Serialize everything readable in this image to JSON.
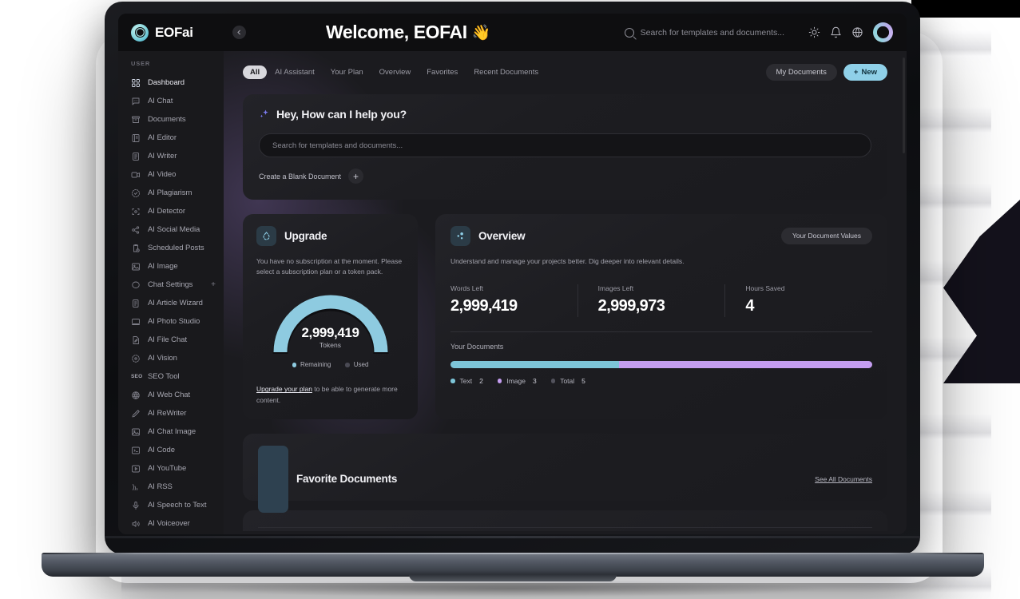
{
  "brand": {
    "name": "EOFai",
    "mark_icon": "eofai-logo-icon"
  },
  "header": {
    "collapse_icon": "chevron-left-icon",
    "welcome": "Welcome, EOFAI",
    "wave_emoji": "👋",
    "search_placeholder": "Search for templates and documents...",
    "search_icon": "search-icon",
    "icons": [
      {
        "name": "theme-toggle-icon",
        "glyph": "sun-icon"
      },
      {
        "name": "notifications-icon",
        "glyph": "bell-icon"
      },
      {
        "name": "language-icon",
        "glyph": "globe-icon"
      }
    ],
    "avatar_name": "user-avatar"
  },
  "sidebar": {
    "section_label": "USER",
    "items": [
      {
        "label": "Dashboard",
        "icon": "grid-icon",
        "active": true
      },
      {
        "label": "AI Chat",
        "icon": "chat-bubble-icon",
        "active": false
      },
      {
        "label": "Documents",
        "icon": "archive-icon",
        "active": false
      },
      {
        "label": "AI Editor",
        "icon": "book-icon",
        "active": false
      },
      {
        "label": "AI Writer",
        "icon": "document-icon",
        "active": false
      },
      {
        "label": "AI Video",
        "icon": "video-camera-icon",
        "active": false
      },
      {
        "label": "AI Plagiarism",
        "icon": "check-circle-icon",
        "active": false
      },
      {
        "label": "AI Detector",
        "icon": "scan-icon",
        "active": false
      },
      {
        "label": "AI Social Media",
        "icon": "share-nodes-icon",
        "active": false
      },
      {
        "label": "Scheduled Posts",
        "icon": "clipboard-clock-icon",
        "active": false
      },
      {
        "label": "AI Image",
        "icon": "image-icon",
        "active": false
      },
      {
        "label": "Chat Settings",
        "icon": "chat-circle-icon",
        "active": false,
        "trailing": "+"
      },
      {
        "label": "AI Article Wizard",
        "icon": "article-wand-icon",
        "active": false
      },
      {
        "label": "AI Photo Studio",
        "icon": "monitor-icon",
        "active": false
      },
      {
        "label": "AI File Chat",
        "icon": "file-pen-icon",
        "active": false
      },
      {
        "label": "AI Vision",
        "icon": "eye-scan-icon",
        "active": false
      },
      {
        "label": "SEO Tool",
        "icon": "seo-text-icon",
        "active": false
      },
      {
        "label": "AI Web Chat",
        "icon": "globe-icon",
        "active": false
      },
      {
        "label": "AI ReWriter",
        "icon": "pencil-icon",
        "active": false
      },
      {
        "label": "AI Chat Image",
        "icon": "image-icon",
        "active": false
      },
      {
        "label": "AI Code",
        "icon": "terminal-icon",
        "active": false
      },
      {
        "label": "AI YouTube",
        "icon": "play-box-icon",
        "active": false
      },
      {
        "label": "AI RSS",
        "icon": "rss-icon",
        "active": false
      },
      {
        "label": "AI Speech to Text",
        "icon": "microphone-icon",
        "active": false
      },
      {
        "label": "AI Voiceover",
        "icon": "speaker-icon",
        "active": false
      }
    ]
  },
  "tabs": [
    {
      "label": "All",
      "active": true
    },
    {
      "label": "AI Assistant",
      "active": false
    },
    {
      "label": "Your Plan",
      "active": false
    },
    {
      "label": "Overview",
      "active": false
    },
    {
      "label": "Favorites",
      "active": false
    },
    {
      "label": "Recent Documents",
      "active": false
    }
  ],
  "toolbar": {
    "my_documents_label": "My Documents",
    "new_label": "New",
    "new_plus": "+"
  },
  "hero": {
    "icon": "sparkle-icon",
    "title": "Hey, How can I help you?",
    "search_placeholder": "Search for templates and documents...",
    "search_value": "",
    "blank_doc_label": "Create a Blank Document",
    "blank_doc_plus": "+"
  },
  "upgrade": {
    "icon": "upgrade-droplet-icon",
    "title": "Upgrade",
    "description": "You have no subscription at the moment. Please select a subscription plan or a token pack.",
    "gauge_value": "2,999,419",
    "gauge_label": "Tokens",
    "legend": [
      {
        "label": "Remaining",
        "color": "#8ecbe0"
      },
      {
        "label": "Used",
        "color": "#4a4a54"
      }
    ],
    "footer_link": "Upgrade your plan",
    "footer_text": " to be able to generate more content.",
    "remaining_percent": 100
  },
  "overview": {
    "icon": "overview-dots-icon",
    "title": "Overview",
    "pill_label": "Your Document Values",
    "description": "Understand and manage your projects better. Dig deeper into relevant details.",
    "stats": [
      {
        "label": "Words Left",
        "value": "2,999,419"
      },
      {
        "label": "Images Left",
        "value": "2,999,973"
      },
      {
        "label": "Hours Saved",
        "value": "4"
      }
    ],
    "documents_label": "Your Documents",
    "bar_segments": [
      {
        "label": "Text",
        "count": 2,
        "color": "#7dc5d8",
        "percent": 40
      },
      {
        "label": "Image",
        "count": 3,
        "color": "#c49df0",
        "percent": 60
      }
    ],
    "bar_legend": [
      {
        "label": "Text",
        "count": "2",
        "color": "#7dc5d8"
      },
      {
        "label": "Image",
        "count": "3",
        "color": "#c49df0"
      },
      {
        "label": "Total",
        "count": "5",
        "color": "#52525c"
      }
    ]
  },
  "favorites": {
    "icon": "star-bookmark-icon",
    "title": "Favorite Documents",
    "see_all_label": "See All Documents"
  },
  "chart_data": {
    "type": "table",
    "title": "Dashboard metrics",
    "gauge": {
      "type": "pie",
      "title": "Tokens",
      "categories": [
        "Remaining",
        "Used"
      ],
      "values": [
        2999419,
        0
      ],
      "center_label": "2,999,419"
    },
    "documents_bar": {
      "type": "bar",
      "title": "Your Documents",
      "categories": [
        "Text",
        "Image",
        "Total"
      ],
      "values": [
        2,
        3,
        5
      ],
      "colors": [
        "#7dc5d8",
        "#c49df0",
        "#52525c"
      ]
    },
    "stats": {
      "categories": [
        "Words Left",
        "Images Left",
        "Hours Saved"
      ],
      "values": [
        2999419,
        2999973,
        4
      ]
    }
  }
}
